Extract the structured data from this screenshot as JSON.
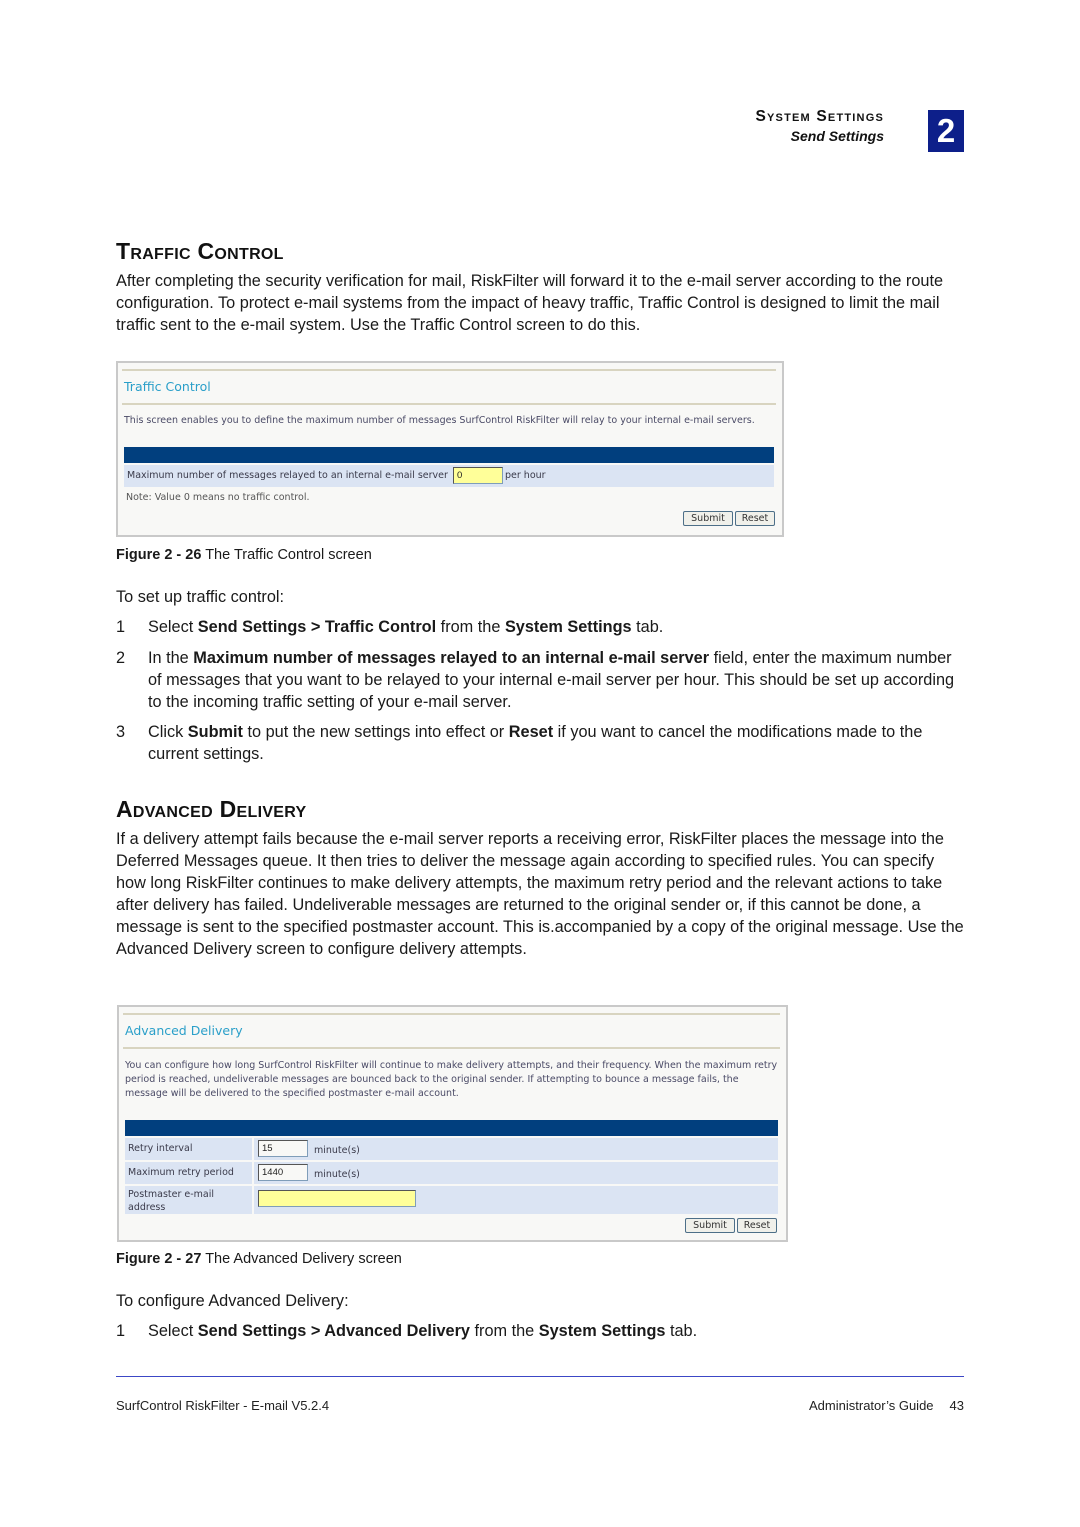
{
  "header": {
    "section": "System Settings",
    "subsection": "Send Settings",
    "chapter_number": "2"
  },
  "traffic_control": {
    "heading": "Traffic Control",
    "intro": "After completing the security verification for mail, RiskFilter will forward it to the e-mail server according to the route configuration. To protect e-mail systems from the impact of heavy traffic, Traffic Control is designed to limit the mail traffic sent to the e-mail system. Use the Traffic Control screen to do this.",
    "screen": {
      "title": "Traffic Control",
      "description": "This screen enables you to define the maximum number of messages SurfControl RiskFilter will relay to your internal e-mail servers.",
      "field_label": "Maximum number of messages relayed to an internal e-mail server",
      "field_value": "0",
      "field_unit": "per hour",
      "note": "Note: Value 0 means no traffic control.",
      "submit_label": "Submit",
      "reset_label": "Reset"
    },
    "figure_label": "Figure 2 - 26",
    "figure_caption": "The Traffic Control screen",
    "steps_intro": "To set up traffic control:",
    "steps": [
      {
        "num": "1",
        "parts": [
          [
            "Select ",
            false
          ],
          [
            "Send Settings > Traffic Control",
            true
          ],
          [
            " from the ",
            false
          ],
          [
            "System Settings",
            true
          ],
          [
            " tab.",
            false
          ]
        ]
      },
      {
        "num": "2",
        "parts": [
          [
            "In the ",
            false
          ],
          [
            "Maximum number of messages relayed to an internal e-mail server",
            true
          ],
          [
            " field, enter the maximum number of messages that you want to be relayed to your internal e-mail server per hour. This should be set up according to the incoming traffic setting of your e-mail server.",
            false
          ]
        ]
      },
      {
        "num": "3",
        "parts": [
          [
            "Click ",
            false
          ],
          [
            "Submit",
            true
          ],
          [
            " to put the new settings into effect or ",
            false
          ],
          [
            "Reset",
            true
          ],
          [
            " if you want to cancel the modifications made to the current settings.",
            false
          ]
        ]
      }
    ]
  },
  "advanced_delivery": {
    "heading": "Advanced Delivery",
    "intro": "If a delivery attempt fails because the e-mail server reports a receiving error, RiskFilter places the message into the Deferred Messages queue. It then tries to deliver the message again according to specified rules. You can specify how long RiskFilter continues to make delivery attempts, the maximum retry period and the relevant actions to take after delivery has failed. Undeliverable messages are returned to the original sender or, if this cannot be done, a message is sent to the specified postmaster account. This is.accompanied by a copy of the original message. Use the Advanced Delivery screen to configure delivery attempts.",
    "screen": {
      "title": "Advanced Delivery",
      "description": "You can configure how long SurfControl RiskFilter will continue to make delivery attempts, and their frequency. When the maximum retry period is reached, undeliverable messages are bounced back to the original sender. If attempting to bounce a message fails, the message will be delivered to the specified postmaster e-mail account.",
      "rows": [
        {
          "label": "Retry interval",
          "value": "15",
          "unit": "minute(s)"
        },
        {
          "label": "Maximum retry period",
          "value": "1440",
          "unit": "minute(s)"
        },
        {
          "label": "Postmaster e-mail address",
          "value": "",
          "unit": ""
        }
      ],
      "submit_label": "Submit",
      "reset_label": "Reset"
    },
    "figure_label": "Figure 2 - 27",
    "figure_caption": "The Advanced Delivery screen",
    "steps_intro": "To configure Advanced Delivery:",
    "steps": [
      {
        "num": "1",
        "parts": [
          [
            "Select ",
            false
          ],
          [
            "Send Settings > Advanced Delivery",
            true
          ],
          [
            " from the ",
            false
          ],
          [
            "System Settings",
            true
          ],
          [
            " tab.",
            false
          ]
        ]
      }
    ]
  },
  "footer": {
    "product": "SurfControl RiskFilter - E-mail V5.2.4",
    "guide": "Administrator’s Guide",
    "page": "43"
  },
  "colors": {
    "chapter_box": "#0d1f8a",
    "screen_title": "#2a9fc9",
    "table_header_bar": "#013f7e",
    "table_row": "#dbe4f3",
    "input_highlight": "#ffff99",
    "footer_rule": "#3c47c6"
  }
}
